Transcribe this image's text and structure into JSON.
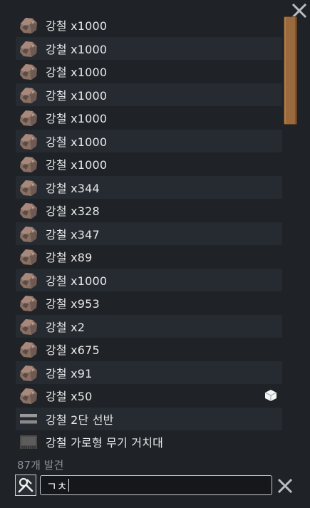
{
  "items": [
    {
      "label": "강철 x1000",
      "icon": "steel-chunk-icon"
    },
    {
      "label": "강철 x1000",
      "icon": "steel-chunk-icon"
    },
    {
      "label": "강철 x1000",
      "icon": "steel-chunk-icon"
    },
    {
      "label": "강철 x1000",
      "icon": "steel-chunk-icon"
    },
    {
      "label": "강철 x1000",
      "icon": "steel-chunk-icon"
    },
    {
      "label": "강철 x1000",
      "icon": "steel-chunk-icon"
    },
    {
      "label": "강철 x1000",
      "icon": "steel-chunk-icon"
    },
    {
      "label": "강철 x344",
      "icon": "steel-chunk-icon"
    },
    {
      "label": "강철 x328",
      "icon": "steel-chunk-icon"
    },
    {
      "label": "강철 x347",
      "icon": "steel-chunk-icon"
    },
    {
      "label": "강철 x89",
      "icon": "steel-chunk-icon"
    },
    {
      "label": "강철 x1000",
      "icon": "steel-chunk-icon"
    },
    {
      "label": "강철 x953",
      "icon": "steel-chunk-icon"
    },
    {
      "label": "강철 x2",
      "icon": "steel-chunk-icon"
    },
    {
      "label": "강철 x675",
      "icon": "steel-chunk-icon"
    },
    {
      "label": "강철 x91",
      "icon": "steel-chunk-icon"
    },
    {
      "label": "강철 x50",
      "icon": "steel-chunk-icon",
      "extra_icon": "cube-icon"
    },
    {
      "label": "강철 2단 선반",
      "icon": "shelf-icon"
    },
    {
      "label": "강철 가로형 무기 거치대",
      "icon": "weapon-rack-icon"
    }
  ],
  "footer": {
    "count_text": "87개 발견",
    "search_value": "ㄱㅊ"
  },
  "colors": {
    "background": "#1f2226",
    "row_alt": "#262b31",
    "scrollbar": "#9a6a3c"
  }
}
